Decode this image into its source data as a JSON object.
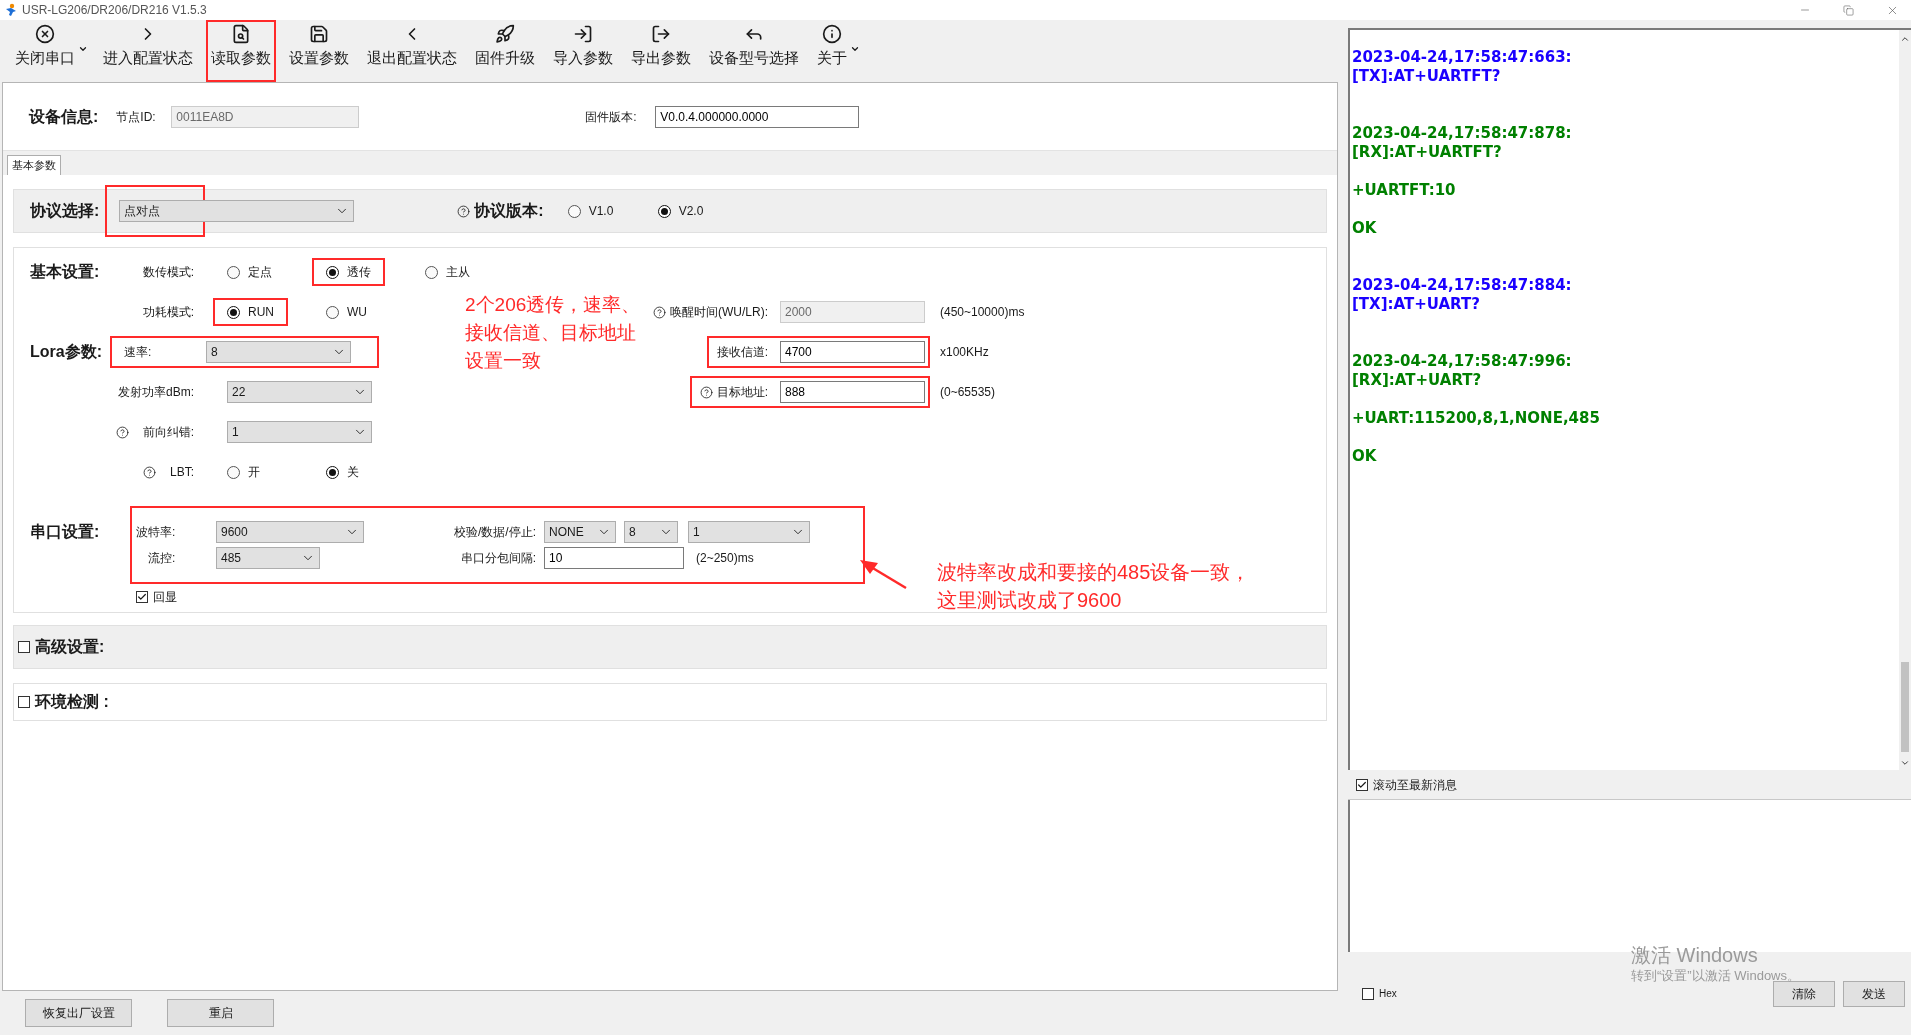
{
  "window": {
    "title": "USR-LG206/DR206/DR216 V1.5.3"
  },
  "toolbar": [
    {
      "label": "关闭串口",
      "menu": true,
      "highlighted": false
    },
    {
      "label": "进入配置状态",
      "menu": false,
      "highlighted": false
    },
    {
      "label": "读取参数",
      "menu": false,
      "highlighted": true
    },
    {
      "label": "设置参数",
      "menu": false,
      "highlighted": false
    },
    {
      "label": "退出配置状态",
      "menu": false,
      "highlighted": false
    },
    {
      "label": "固件升级",
      "menu": false,
      "highlighted": false
    },
    {
      "label": "导入参数",
      "menu": false,
      "highlighted": false
    },
    {
      "label": "导出参数",
      "menu": false,
      "highlighted": false
    },
    {
      "label": "设备型号选择",
      "menu": false,
      "highlighted": false
    },
    {
      "label": "关于",
      "menu": true,
      "highlighted": false
    }
  ],
  "device_info": {
    "title": "设备信息:",
    "node_id": {
      "label": "节点ID:",
      "value": "0011EA8D",
      "disabled": true
    },
    "firmware": {
      "label": "固件版本:",
      "value": "V0.0.4.000000.0000",
      "disabled": false
    }
  },
  "tabs": [
    {
      "label": "基本参数",
      "selected": true
    }
  ],
  "protocol": {
    "title": "协议选择:",
    "select": {
      "value": "点对点",
      "highlighted": true
    },
    "version_label": "协议版本:",
    "versions": [
      {
        "label": "V1.0",
        "selected": false
      },
      {
        "label": "V2.0",
        "selected": true
      }
    ]
  },
  "basic": {
    "title": "基本设置:",
    "mode": {
      "label": "数传模式:",
      "options": [
        {
          "label": "定点",
          "selected": false,
          "highlighted": false
        },
        {
          "label": "透传",
          "selected": true,
          "highlighted": true
        },
        {
          "label": "主从",
          "selected": false,
          "highlighted": false
        }
      ]
    },
    "power": {
      "label": "功耗模式:",
      "options": [
        {
          "label": "RUN",
          "selected": true,
          "highlighted": true
        },
        {
          "label": "WU",
          "selected": false,
          "highlighted": false
        }
      ]
    },
    "wake": {
      "label": "唤醒时间(WU/LR):",
      "help": true,
      "value": "2000",
      "disabled": true,
      "unit": "(450~10000)ms"
    }
  },
  "lora": {
    "title": "Lora参数:",
    "rate": {
      "label": "速率:",
      "value": "8",
      "highlighted": true
    },
    "tx_power": {
      "label": "发射功率dBm:",
      "value": "22"
    },
    "fec": {
      "label": "前向纠错:",
      "help": true,
      "value": "1"
    },
    "lbt": {
      "label": "LBT:",
      "help": true,
      "options": [
        {
          "label": "开",
          "selected": false
        },
        {
          "label": "关",
          "selected": true
        }
      ]
    },
    "channel": {
      "label": "接收信道:",
      "value": "4700",
      "disabled": false,
      "unit": "x100KHz",
      "highlighted": true
    },
    "address": {
      "label": "目标地址:",
      "help": true,
      "value": "888",
      "disabled": false,
      "unit": "(0~65535)",
      "highlighted": true
    }
  },
  "serial": {
    "title": "串口设置:",
    "highlighted": true,
    "baud": {
      "label": "波特率:",
      "value": "9600"
    },
    "flow": {
      "label": "流控:",
      "value": "485"
    },
    "format": {
      "label": "校验/数据/停止:",
      "parity": "NONE",
      "data_bits": "8",
      "stop_bits": "1"
    },
    "gap": {
      "label": "串口分包间隔:",
      "value": "10",
      "unit": "(2~250)ms"
    },
    "echo": {
      "label": "回显",
      "checked": true
    }
  },
  "advanced": {
    "label": "高级设置:",
    "checked": false
  },
  "environment": {
    "label": "环境检测 :",
    "checked": false
  },
  "annotations": [
    {
      "kind": "note",
      "lines": [
        "2个206透传，速率、",
        "接收信道、目标地址",
        "设置一致"
      ]
    },
    {
      "kind": "arrow-note",
      "lines": [
        "波特率改成和要接的485设备一致，",
        "这里测试改成了9600"
      ]
    }
  ],
  "footer_buttons": [
    "恢复出厂设置",
    "重启"
  ],
  "log": {
    "entries": [
      {
        "kind": "tx",
        "header": [
          "2023-04-24,17:58:47:663:",
          "[TX]:AT+UARTFT?"
        ]
      },
      {
        "kind": "rx",
        "header": [
          "2023-04-24,17:58:47:878:",
          "[RX]:AT+UARTFT?"
        ],
        "body": [
          "+UARTFT:10",
          "OK"
        ]
      },
      {
        "kind": "tx",
        "header": [
          "2023-04-24,17:58:47:884:",
          "[TX]:AT+UART?"
        ]
      },
      {
        "kind": "rx",
        "header": [
          "2023-04-24,17:58:47:996:",
          "[RX]:AT+UART?"
        ],
        "body": [
          "+UART:115200,8,1,NONE,485",
          "OK"
        ]
      }
    ],
    "autoscroll": {
      "label": "滚动至最新消息",
      "checked": true
    },
    "hex": {
      "label": "Hex",
      "checked": false
    },
    "buttons": [
      "清除",
      "发送"
    ]
  },
  "os_notice": {
    "title": "激活 Windows",
    "text": "转到“设置”以激活 Windows。"
  }
}
